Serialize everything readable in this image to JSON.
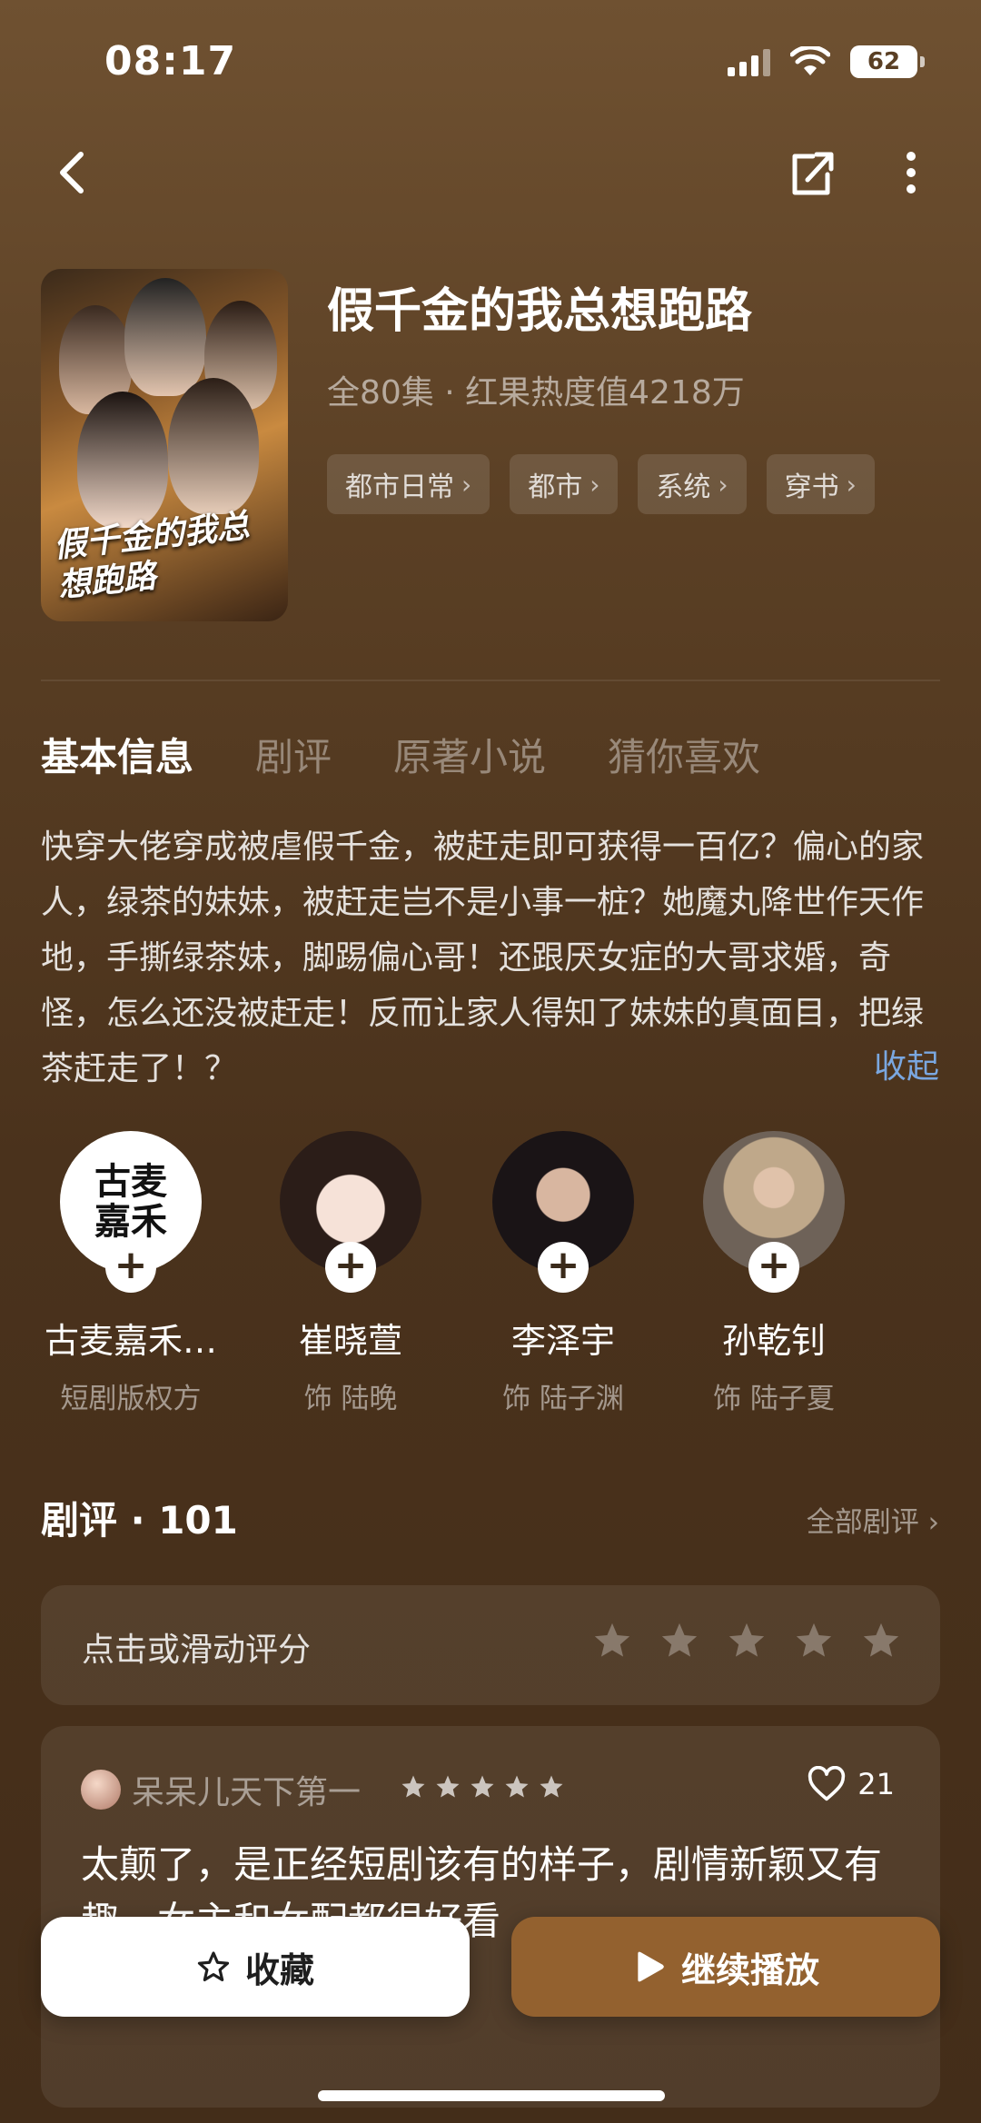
{
  "status_bar": {
    "time": "08:17",
    "battery": "62"
  },
  "drama": {
    "title": "假千金的我总想跑路",
    "meta": "全80集 · 红果热度值4218万",
    "poster_text": "假千金的我总想跑路",
    "tags": [
      "都市日常",
      "都市",
      "系统",
      "穿书"
    ]
  },
  "tabs": [
    "基本信息",
    "剧评",
    "原著小说",
    "猜你喜欢"
  ],
  "synopsis": "快穿大佬穿成被虐假千金，被赶走即可获得一百亿？偏心的家人，绿茶的妹妹，被赶走岂不是小事一桩？她魔丸降世作天作地，手撕绿茶妹，脚踢偏心哥！还跟厌女症的大哥求婚，奇怪，怎么还没被赶走！反而让家人得知了妹妹的真面目，把绿茶赶走了！？",
  "collapse_label": "收起",
  "cast": [
    {
      "name": "古麦嘉禾…",
      "role": "短剧版权方",
      "logo_text": "古麦嘉禾"
    },
    {
      "name": "崔晓萱",
      "role": "饰 陆晚"
    },
    {
      "name": "李泽宇",
      "role": "饰 陆子渊"
    },
    {
      "name": "孙乾钊",
      "role": "饰 陆子夏"
    }
  ],
  "reviews": {
    "heading": "剧评 · 101",
    "all_label": "全部剧评",
    "rate_prompt": "点击或滑动评分",
    "rating_max": 5,
    "first": {
      "user": "呆呆儿天下第一",
      "stars": 5,
      "likes": "21",
      "text": "太颠了，是正经短剧该有的样子，剧情新颖又有趣，女主和女配都很好看"
    }
  },
  "actions": {
    "favorite": "收藏",
    "continue": "继续播放"
  },
  "colors": {
    "accent_blue": "#7aa7e0",
    "play_button": "#93612f"
  }
}
